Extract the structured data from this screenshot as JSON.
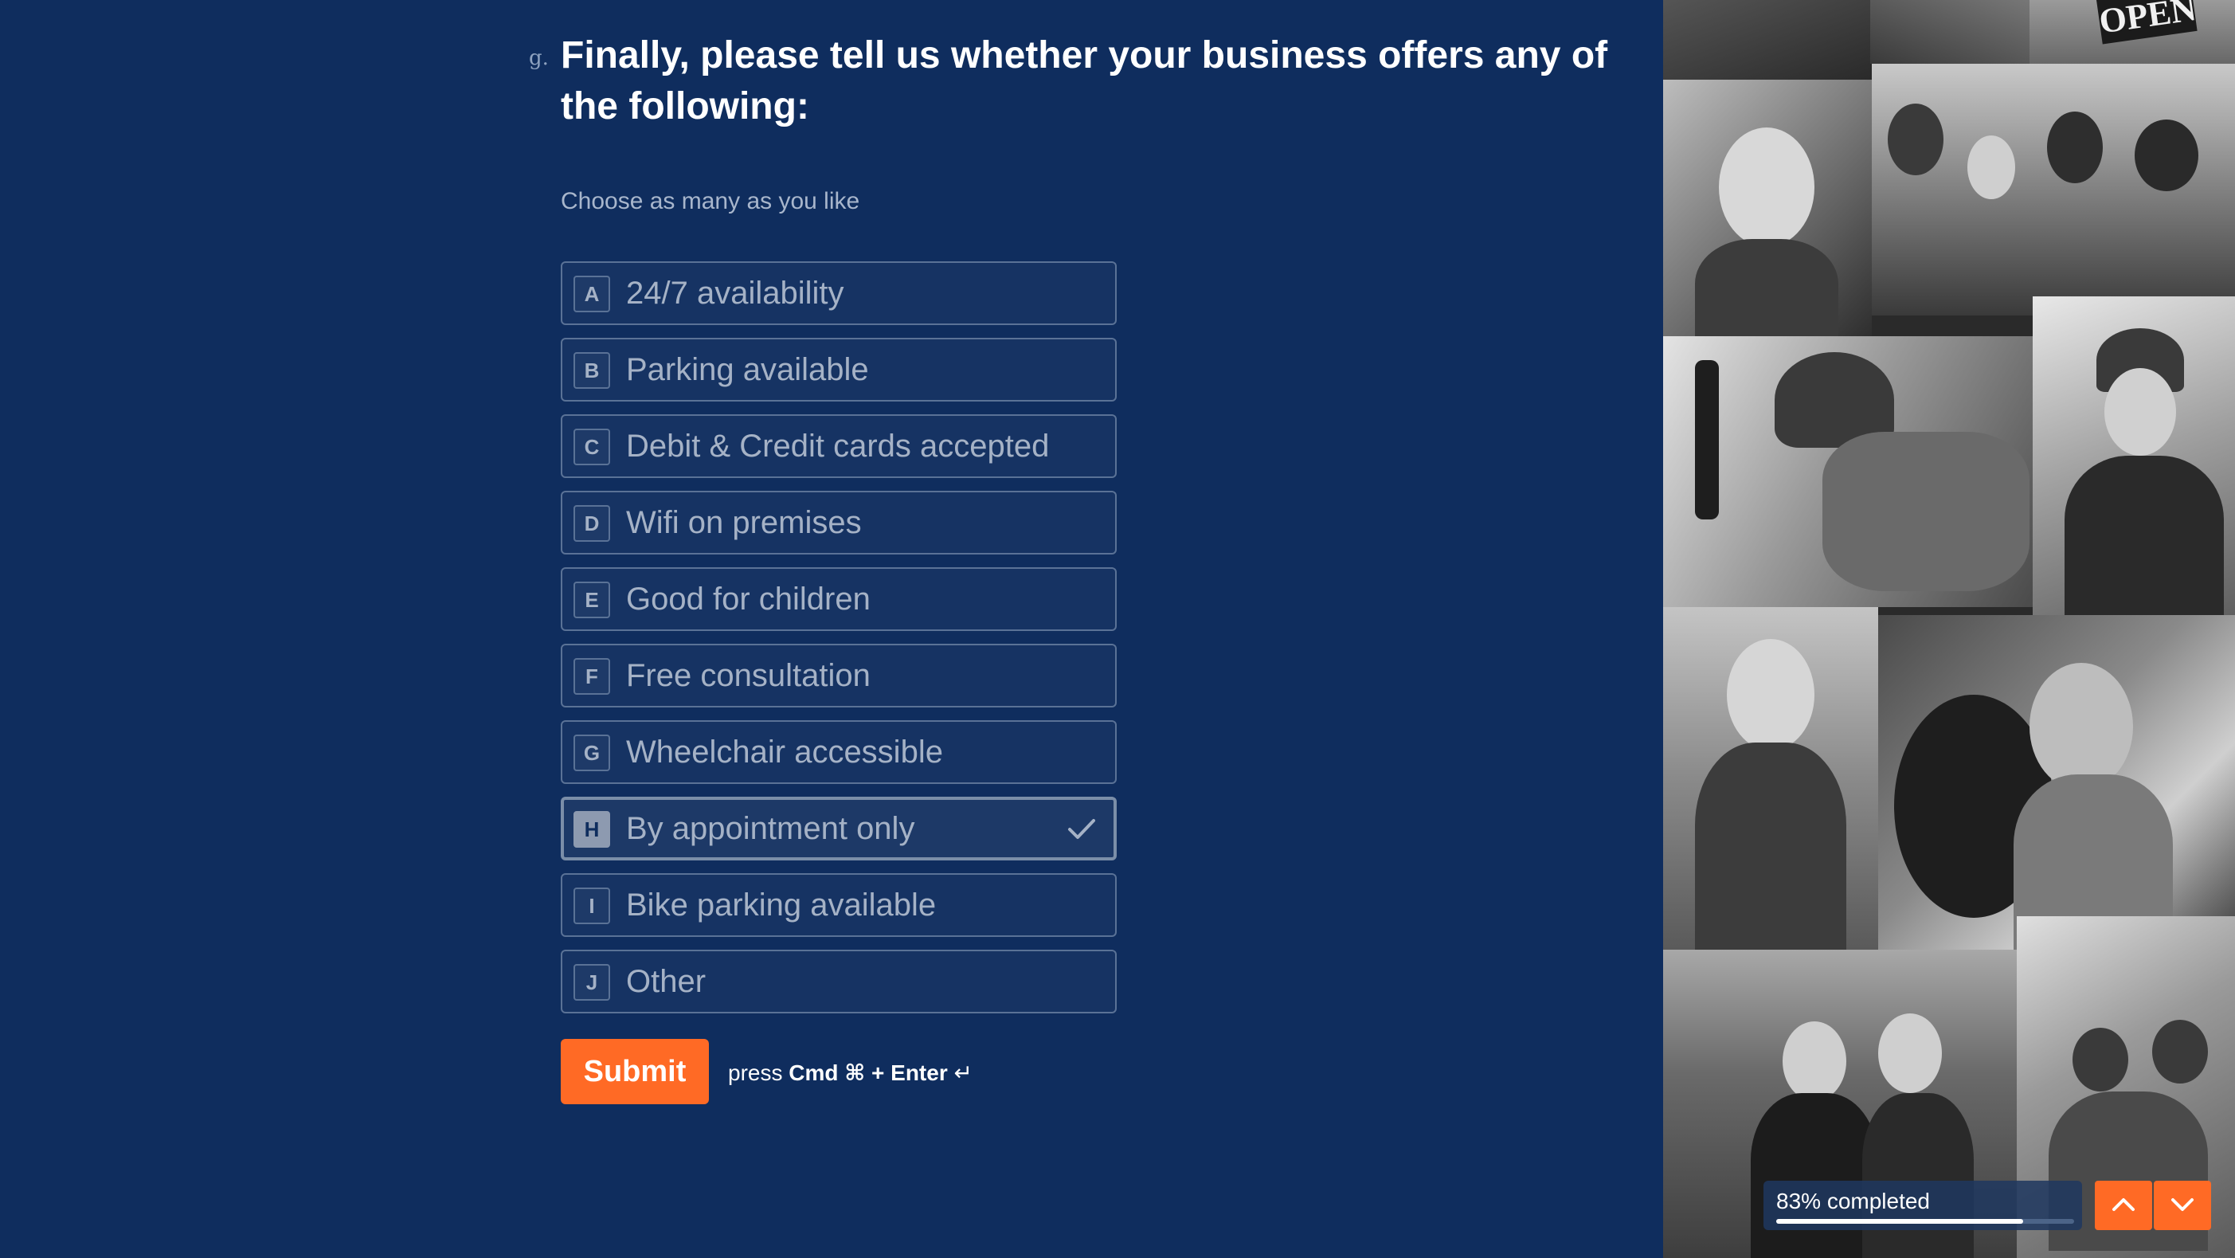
{
  "question": {
    "number": "g.",
    "title": "Finally, please tell us whether your business offers any of the following:",
    "hint": "Choose as many as you like"
  },
  "choices": [
    {
      "key": "A",
      "label": "24/7 availability",
      "selected": false
    },
    {
      "key": "B",
      "label": "Parking available",
      "selected": false
    },
    {
      "key": "C",
      "label": "Debit & Credit cards accepted",
      "selected": false
    },
    {
      "key": "D",
      "label": "Wifi on premises",
      "selected": false
    },
    {
      "key": "E",
      "label": "Good for children",
      "selected": false
    },
    {
      "key": "F",
      "label": "Free consultation",
      "selected": false
    },
    {
      "key": "G",
      "label": "Wheelchair accessible",
      "selected": false
    },
    {
      "key": "H",
      "label": "By appointment only",
      "selected": true
    },
    {
      "key": "I",
      "label": "Bike parking available",
      "selected": false
    },
    {
      "key": "J",
      "label": "Other",
      "selected": false
    }
  ],
  "submit": {
    "label": "Submit",
    "hint_prefix": "press",
    "hint_keys": "Cmd ⌘ + Enter",
    "hint_icon": "↵"
  },
  "photo_panel": {
    "sign_text": "OPEN"
  },
  "progress": {
    "text": "83% completed",
    "fraction": 0.83
  },
  "navigation": {
    "up_icon": "chevron-up-icon",
    "down_icon": "chevron-down-icon"
  },
  "colors": {
    "background": "#0f2d5e",
    "accent": "#ff6a25",
    "choice_border": "#5a7296",
    "choice_text": "#a5b2c6"
  }
}
